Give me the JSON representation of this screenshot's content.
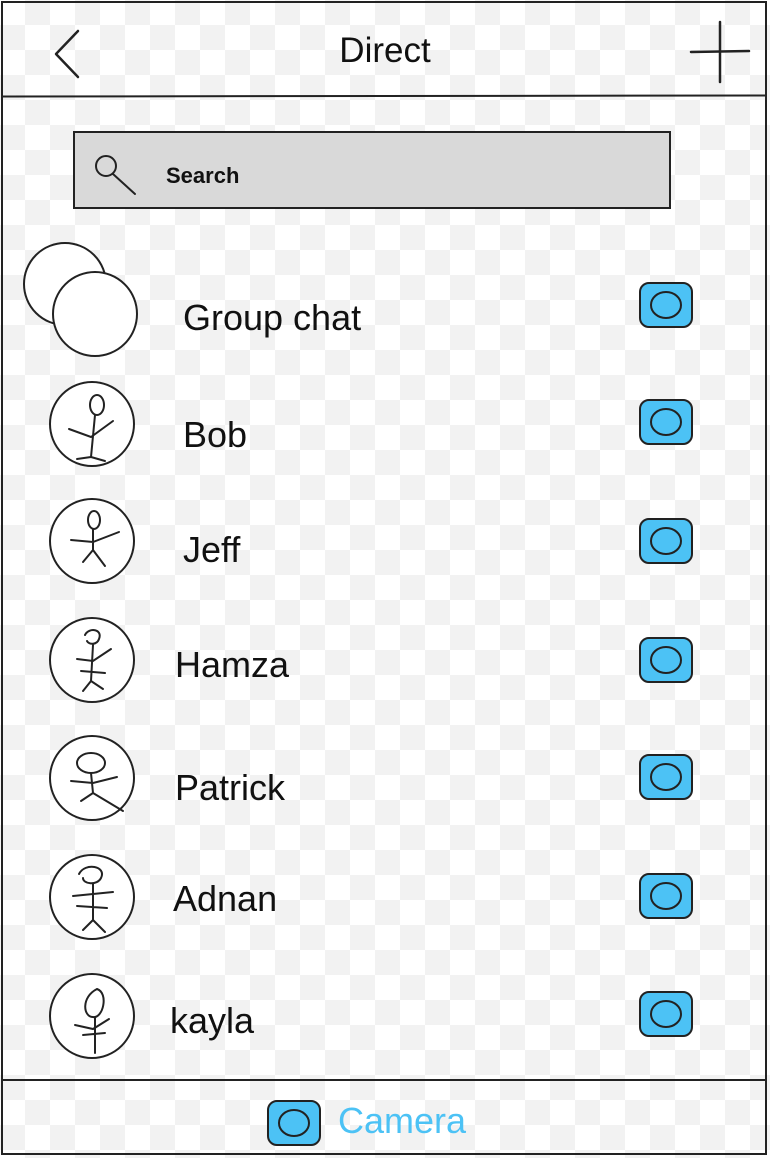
{
  "header": {
    "title": "Direct",
    "back_icon": "chevron-left-icon",
    "add_icon": "plus-icon"
  },
  "search": {
    "label": "Search",
    "icon": "search-icon"
  },
  "conversations": [
    {
      "name": "Group chat",
      "avatar": "group-avatar-icon"
    },
    {
      "name": "Bob",
      "avatar": "stick-figure-avatar"
    },
    {
      "name": "Jeff",
      "avatar": "stick-figure-avatar"
    },
    {
      "name": "Hamza",
      "avatar": "stick-figure-avatar"
    },
    {
      "name": "Patrick",
      "avatar": "stick-figure-avatar"
    },
    {
      "name": "Adnan",
      "avatar": "stick-figure-avatar"
    },
    {
      "name": "kayla",
      "avatar": "stick-figure-avatar"
    }
  ],
  "footer": {
    "camera_label": "Camera",
    "camera_icon": "camera-icon"
  },
  "colors": {
    "accent": "#4cc2f5",
    "search_bg": "#d9d9d9",
    "stroke": "#222222"
  }
}
